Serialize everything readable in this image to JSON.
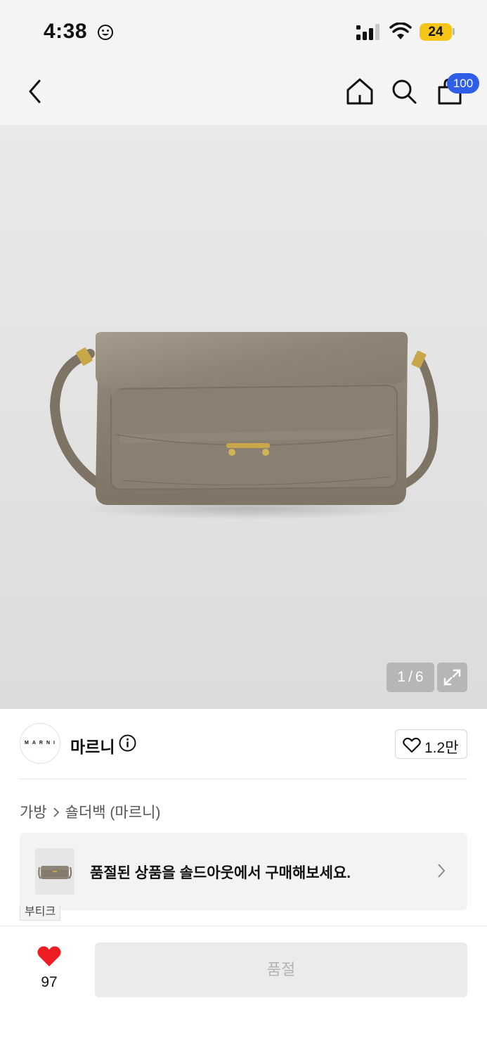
{
  "status": {
    "time": "4:38",
    "battery": "24"
  },
  "nav": {
    "cart_badge": "100",
    "icons": [
      "back-icon",
      "home-icon",
      "search-icon",
      "shopping-bag-icon"
    ]
  },
  "gallery": {
    "current": "1",
    "total": "6",
    "separator": "/"
  },
  "brand": {
    "logo_text": "MARNI",
    "name": "마르니",
    "like_count": "1.2만"
  },
  "breadcrumb": {
    "category": "가방",
    "subcategory": "숄더백 (마르니)"
  },
  "soldout_banner": {
    "text": "품절된 상품을 솔드아웃에서 구매해보세요.",
    "tag": "부티크"
  },
  "bottom": {
    "wish_count": "97",
    "buy_label": "품절"
  },
  "colors": {
    "accent_blue": "#2f5fe8",
    "heart_red": "#ee1c25",
    "battery_yellow": "#f5c518",
    "bag_taupe": "#8d8374"
  }
}
